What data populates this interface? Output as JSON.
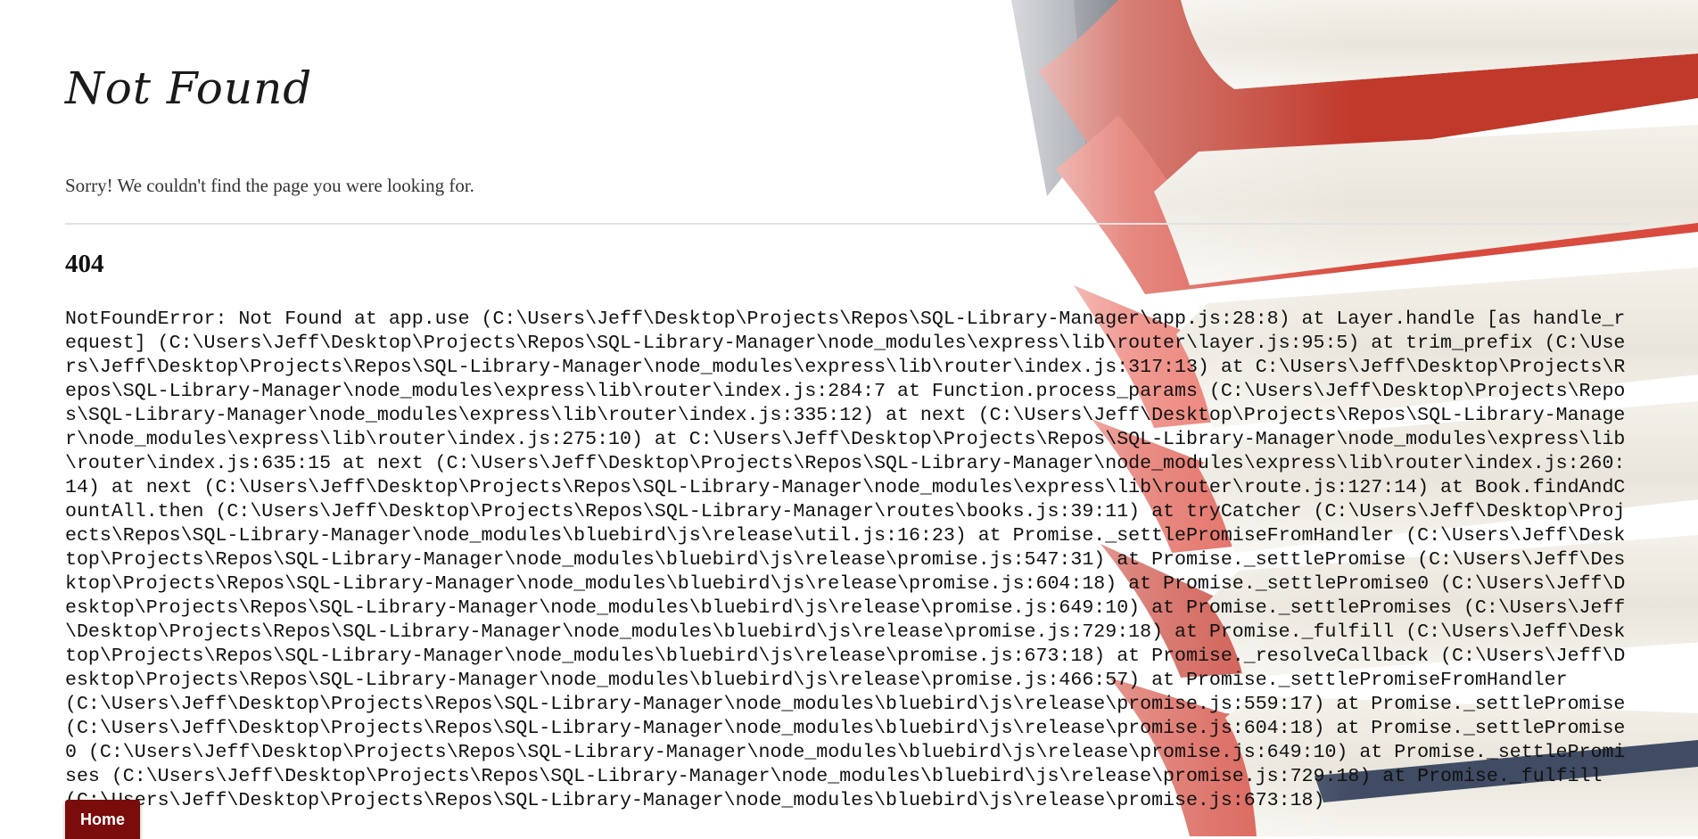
{
  "page": {
    "title": "Not Found",
    "message": "Sorry! We couldn't find the page you were looking for.",
    "status": "404",
    "stack": "NotFoundError: Not Found at app.use (C:\\Users\\Jeff\\Desktop\\Projects\\Repos\\SQL-Library-Manager\\app.js:28:8) at Layer.handle [as handle_request] (C:\\Users\\Jeff\\Desktop\\Projects\\Repos\\SQL-Library-Manager\\node_modules\\express\\lib\\router\\layer.js:95:5) at trim_prefix (C:\\Users\\Jeff\\Desktop\\Projects\\Repos\\SQL-Library-Manager\\node_modules\\express\\lib\\router\\index.js:317:13) at C:\\Users\\Jeff\\Desktop\\Projects\\Repos\\SQL-Library-Manager\\node_modules\\express\\lib\\router\\index.js:284:7 at Function.process_params (C:\\Users\\Jeff\\Desktop\\Projects\\Repos\\SQL-Library-Manager\\node_modules\\express\\lib\\router\\index.js:335:12) at next (C:\\Users\\Jeff\\Desktop\\Projects\\Repos\\SQL-Library-Manager\\node_modules\\express\\lib\\router\\index.js:275:10) at C:\\Users\\Jeff\\Desktop\\Projects\\Repos\\SQL-Library-Manager\\node_modules\\express\\lib\\router\\index.js:635:15 at next (C:\\Users\\Jeff\\Desktop\\Projects\\Repos\\SQL-Library-Manager\\node_modules\\express\\lib\\router\\index.js:260:14) at next (C:\\Users\\Jeff\\Desktop\\Projects\\Repos\\SQL-Library-Manager\\node_modules\\express\\lib\\router\\route.js:127:14) at Book.findAndCountAll.then (C:\\Users\\Jeff\\Desktop\\Projects\\Repos\\SQL-Library-Manager\\routes\\books.js:39:11) at tryCatcher (C:\\Users\\Jeff\\Desktop\\Projects\\Repos\\SQL-Library-Manager\\node_modules\\bluebird\\js\\release\\util.js:16:23) at Promise._settlePromiseFromHandler (C:\\Users\\Jeff\\Desktop\\Projects\\Repos\\SQL-Library-Manager\\node_modules\\bluebird\\js\\release\\promise.js:547:31) at Promise._settlePromise (C:\\Users\\Jeff\\Desktop\\Projects\\Repos\\SQL-Library-Manager\\node_modules\\bluebird\\js\\release\\promise.js:604:18) at Promise._settlePromise0 (C:\\Users\\Jeff\\Desktop\\Projects\\Repos\\SQL-Library-Manager\\node_modules\\bluebird\\js\\release\\promise.js:649:10) at Promise._settlePromises (C:\\Users\\Jeff\\Desktop\\Projects\\Repos\\SQL-Library-Manager\\node_modules\\bluebird\\js\\release\\promise.js:729:18) at Promise._fulfill (C:\\Users\\Jeff\\Desktop\\Projects\\Repos\\SQL-Library-Manager\\node_modules\\bluebird\\js\\release\\promise.js:673:18) at Promise._resolveCallback (C:\\Users\\Jeff\\Desktop\\Projects\\Repos\\SQL-Library-Manager\\node_modules\\bluebird\\js\\release\\promise.js:466:57) at Promise._settlePromiseFromHandler (C:\\Users\\Jeff\\Desktop\\Projects\\Repos\\SQL-Library-Manager\\node_modules\\bluebird\\js\\release\\promise.js:559:17) at Promise._settlePromise (C:\\Users\\Jeff\\Desktop\\Projects\\Repos\\SQL-Library-Manager\\node_modules\\bluebird\\js\\release\\promise.js:604:18) at Promise._settlePromise0 (C:\\Users\\Jeff\\Desktop\\Projects\\Repos\\SQL-Library-Manager\\node_modules\\bluebird\\js\\release\\promise.js:649:10) at Promise._settlePromises (C:\\Users\\Jeff\\Desktop\\Projects\\Repos\\SQL-Library-Manager\\node_modules\\bluebird\\js\\release\\promise.js:729:18) at Promise._fulfill (C:\\Users\\Jeff\\Desktop\\Projects\\Repos\\SQL-Library-Manager\\node_modules\\bluebird\\js\\release\\promise.js:673:18)"
  },
  "nav": {
    "home_label": "Home"
  },
  "background": {
    "icon": "book-stack-illustration"
  },
  "colors": {
    "accent": "#7a0c0c",
    "background": "#ffffff",
    "divider": "#e2e2e2"
  }
}
